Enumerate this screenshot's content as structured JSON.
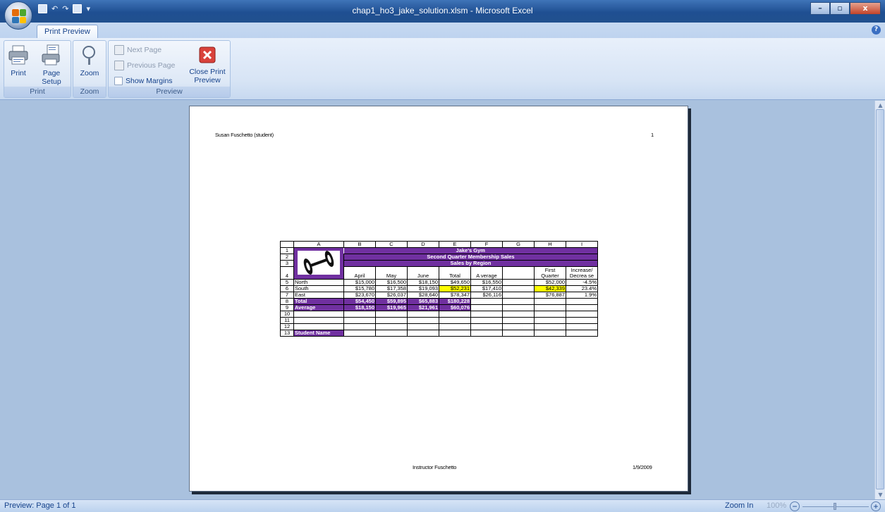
{
  "window": {
    "title": "chap1_ho3_jake_solution.xlsm - Microsoft Excel",
    "minimize": "–",
    "maximize": "▫",
    "close": "x"
  },
  "qat": {
    "undo": "↶",
    "redo": "↷",
    "dropdown": "▾"
  },
  "ribbon": {
    "tab": "Print Preview",
    "help": "?",
    "groups": {
      "print": {
        "label": "Print",
        "print_button": "Print",
        "page_setup_button_line1": "Page",
        "page_setup_button_line2": "Setup"
      },
      "zoom": {
        "label": "Zoom",
        "zoom_button": "Zoom"
      },
      "preview": {
        "label": "Preview",
        "next_page": "Next Page",
        "previous_page": "Previous Page",
        "show_margins": "Show Margins",
        "close_preview_line1": "Close Print",
        "close_preview_line2": "Preview"
      }
    }
  },
  "page": {
    "header_left": "Susan Fuschetto (student)",
    "header_right": "1",
    "footer_center": "Instructor Fuschetto",
    "footer_right": "1/9/2009"
  },
  "sheet": {
    "columns": [
      "A",
      "B",
      "C",
      "D",
      "E",
      "F",
      "G",
      "H",
      "I"
    ],
    "rownums": [
      "1",
      "2",
      "3",
      "4",
      "5",
      "6",
      "7",
      "8",
      "9",
      "10",
      "11",
      "12",
      "13"
    ],
    "title1": "Jake's Gym",
    "title2": "Second Quarter Membership Sales",
    "title3": "Sales by Region",
    "headers": {
      "april": "April",
      "may": "May",
      "june": "June",
      "total": "Total",
      "average": "A verage",
      "first1": "First",
      "first2": "Quarter",
      "inc1": "Increase/",
      "inc2": "Decrea se"
    },
    "rows": [
      {
        "region": "North",
        "april": "$15,000",
        "may": "$16,500",
        "june": "$18,150",
        "total": "$49,650",
        "avg": "$16,550",
        "first": "$52,000",
        "inc": "-4.5%"
      },
      {
        "region": "South",
        "april": "$15,780",
        "may": "$17,358",
        "june": "$19,093",
        "total": "$52,231",
        "avg": "$17,410",
        "first": "$42,339",
        "inc": "23.4%"
      },
      {
        "region": "East",
        "april": "$23,670",
        "may": "$26,037",
        "june": "$28,640",
        "total": "$78,347",
        "avg": "$26,116",
        "first": "$76,887",
        "inc": "1.9%"
      }
    ],
    "total_row": {
      "label": "Total",
      "april": "$54,450",
      "may": "$59,895",
      "june": "$65,883",
      "total": "$180,228"
    },
    "average_row": {
      "label": "Average",
      "april": "$18,150",
      "may": "$19,965",
      "june": "$21,961",
      "total": "$60,076"
    },
    "student_name": "Student Name"
  },
  "status": {
    "left": "Preview: Page 1 of 1",
    "zoom_in": "Zoom In",
    "zoom_pct": "100%",
    "zoom_minus": "−",
    "zoom_plus": "+"
  },
  "scroll": {
    "up": "▲",
    "down": "▼"
  },
  "colors": {
    "purple_fill": "#7030a0",
    "highlight": "#ffff00",
    "ribbon_text": "#15428b"
  }
}
